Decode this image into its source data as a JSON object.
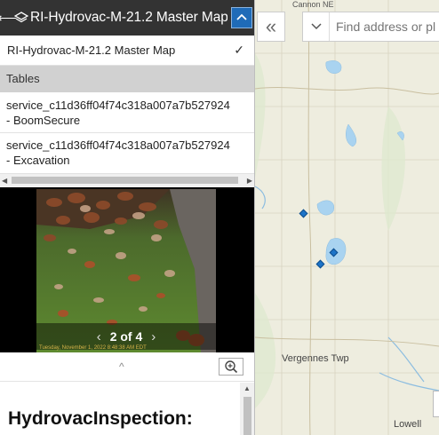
{
  "panel": {
    "back_glyph": "⟵",
    "title": "RI-Hydrovac-M-21.2 Master Map",
    "map_item": "RI-Hydrovac-M-21.2 Master Map",
    "map_item_check": "✓",
    "tables_header": "Tables",
    "tables": [
      {
        "line1": "service_c11d36ff04f74c318a007a7b527924",
        "line2": "- BoomSecure"
      },
      {
        "line1": "service_c11d36ff04f74c318a007a7b527924",
        "line2": "- Excavation"
      }
    ]
  },
  "photo": {
    "pager_text": "2 of 4",
    "prev": "‹",
    "next": "›",
    "stamp": "Tuesday, November 1, 2022 8:48:38 AM EDT"
  },
  "tools": {
    "caret": "^"
  },
  "popup": {
    "title": "HydrovacInspection:"
  },
  "map": {
    "search_placeholder": "Find address or pl",
    "collapse_glyph": "«",
    "labels": {
      "top": "Cannon NE",
      "vergennes": "Vergennes Twp",
      "lowell": "Lowell"
    }
  },
  "colors": {
    "header_bg": "#333333",
    "accent": "#1f6bb8",
    "marker": "#1d74c8",
    "water": "#a9d3f0",
    "map_bg": "#eeeddf"
  }
}
